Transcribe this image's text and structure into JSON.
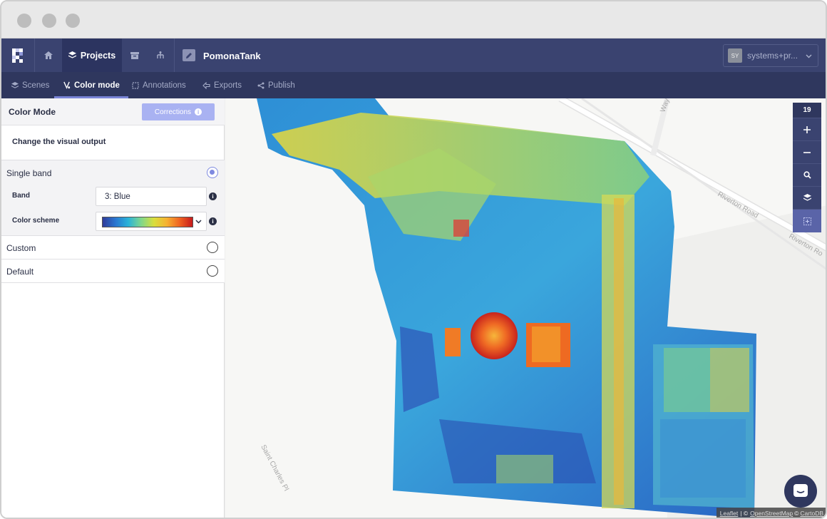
{
  "window": {
    "controls": [
      "close-dot",
      "minimize-dot",
      "zoom-dot"
    ]
  },
  "topnav": {
    "logo_icon": "raster-foundry-logo",
    "home_icon": "home-icon",
    "projects_label": "Projects",
    "project_name": "PomonaTank",
    "user_initials": "SY",
    "user_name": "systems+pr...",
    "accent": "#3a4370"
  },
  "subnav": {
    "tabs": [
      {
        "label": "Scenes",
        "icon": "layers-icon"
      },
      {
        "label": "Color mode",
        "icon": "color-mode-icon",
        "active": true
      },
      {
        "label": "Annotations",
        "icon": "annotation-icon"
      },
      {
        "label": "Exports",
        "icon": "export-icon"
      },
      {
        "label": "Publish",
        "icon": "share-icon"
      }
    ]
  },
  "sidebar": {
    "title": "Color Mode",
    "corrections_label": "Corrections",
    "subtitle": "Change the visual output",
    "options": {
      "single_band": "Single band",
      "custom": "Custom",
      "default": "Default"
    },
    "selected_option": "single_band",
    "band_label": "Band",
    "band_value": "3: Blue",
    "color_scheme_label": "Color scheme",
    "color_scheme_colors": [
      "#303c9a",
      "#2a76d0",
      "#2bb3d8",
      "#7fd78c",
      "#d9de3c",
      "#f6b131",
      "#ef6322",
      "#c61b1c"
    ]
  },
  "map": {
    "zoom_level": "19",
    "road_labels": [
      "Riverton Road",
      "Riverton Ro",
      "Saint Charles Pl",
      "Way"
    ],
    "attribution": {
      "leaflet": "Leaflet",
      "sep1": "| ©",
      "osm": "OpenStreetMap",
      "sep2": "©",
      "carto": "CartoDB"
    }
  }
}
